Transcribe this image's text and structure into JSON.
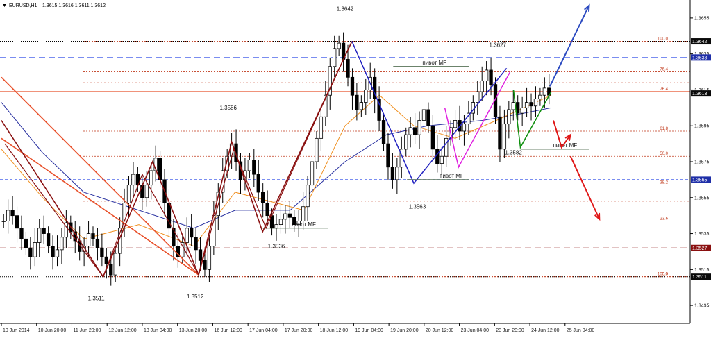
{
  "window": {
    "symbol_title": "EURUSD,H1",
    "ohlc": "1.3615 1.3616 1.3611 1.3612",
    "dropdown_glyph": "▼"
  },
  "colors": {
    "background": "#ffffff",
    "candle": "#000000",
    "fib": "#c0391b",
    "blue_dash": "#2a49e8",
    "price_box": "#0a0a0a",
    "price_box_blue": "#1f2fa8",
    "price_box_red": "#8a1010",
    "price_box_text": "#ffffff",
    "ma_fast": "#f09020",
    "ma_slow": "#2830a0",
    "zigzag_dark": "#8a1010",
    "zigzag_red": "#e8502a",
    "zigzag_blue": "#2020c0",
    "zigzag_magenta": "#e020e0",
    "zigzag_green": "#109010",
    "arrow_blue": "#2a49c0",
    "arrow_red": "#e01818",
    "pivot_line": "#3a5a3a"
  },
  "chart_data": {
    "type": "candlestick",
    "instrument": "EURUSD",
    "timeframe": "H1",
    "ylim": [
      1.3485,
      1.3665
    ],
    "y_ticks": [
      1.3495,
      1.3515,
      1.3535,
      1.3555,
      1.3575,
      1.3595,
      1.3615,
      1.3635,
      1.3655
    ],
    "x_ticks": [
      "10 Jun 2014",
      "10 Jun 20:00",
      "11 Jun 20:00",
      "12 Jun 12:00",
      "13 Jun 04:00",
      "13 Jun 20:00",
      "16 Jun 12:00",
      "17 Jun 04:00",
      "17 Jun 20:00",
      "18 Jun 12:00",
      "19 Jun 04:00",
      "19 Jun 20:00",
      "20 Jun 12:00",
      "23 Jun 04:00",
      "23 Jun 20:00",
      "24 Jun 12:00",
      "25 Jun 04:00"
    ],
    "closes": [
      1.3542,
      1.3548,
      1.3545,
      1.3538,
      1.3532,
      1.3527,
      1.3522,
      1.353,
      1.3538,
      1.3535,
      1.3528,
      1.3522,
      1.3526,
      1.3533,
      1.3541,
      1.3536,
      1.3531,
      1.3525,
      1.3528,
      1.3535,
      1.3532,
      1.3527,
      1.3522,
      1.3518,
      1.3512,
      1.3524,
      1.3538,
      1.3552,
      1.3562,
      1.3568,
      1.3562,
      1.3555,
      1.3562,
      1.357,
      1.3577,
      1.3565,
      1.3552,
      1.3538,
      1.3528,
      1.3522,
      1.353,
      1.3538,
      1.3533,
      1.3526,
      1.352,
      1.3515,
      1.3528,
      1.3545,
      1.3558,
      1.357,
      1.3578,
      1.3585,
      1.3575,
      1.3565,
      1.357,
      1.3576,
      1.3568,
      1.3558,
      1.3552,
      1.3545,
      1.3538,
      1.354,
      1.3543,
      1.3546,
      1.3544,
      1.354,
      1.3542,
      1.355,
      1.3562,
      1.3575,
      1.3588,
      1.36,
      1.3612,
      1.3628,
      1.3638,
      1.3641,
      1.3632,
      1.3622,
      1.3612,
      1.3604,
      1.3608,
      1.3615,
      1.3622,
      1.361,
      1.3598,
      1.3585,
      1.3572,
      1.3565,
      1.3572,
      1.3582,
      1.359,
      1.3594,
      1.359,
      1.3598,
      1.3604,
      1.3595,
      1.3582,
      1.3574,
      1.3578,
      1.3588,
      1.3594,
      1.3598,
      1.3592,
      1.3596,
      1.3602,
      1.3608,
      1.3614,
      1.362,
      1.3626,
      1.3618,
      1.36,
      1.3582,
      1.3596,
      1.3604,
      1.3608,
      1.3602,
      1.3605,
      1.3608,
      1.3606,
      1.361,
      1.3612,
      1.3616,
      1.3612
    ],
    "fib_levels": [
      {
        "label": "100.0",
        "price": 1.3642
      },
      {
        "label": "76.4",
        "price": 1.3625
      },
      {
        "label": "76.4",
        "price": 1.3614
      },
      {
        "label": "61.8",
        "price": 1.3592
      },
      {
        "label": "50.0",
        "price": 1.3578
      },
      {
        "label": "38.2",
        "price": 1.3562
      },
      {
        "label": "23.6",
        "price": 1.3542
      },
      {
        "label": "0.0",
        "price": 1.3511
      },
      {
        "label": "100.0",
        "price": 1.3511
      }
    ],
    "extra_levels": [
      1.3619,
      1.3596,
      1.3553
    ],
    "dashed_lines": [
      {
        "price": 1.3633,
        "style": "long-dash",
        "color": "blue_dash"
      },
      {
        "price": 1.3565,
        "style": "dash",
        "color": "blue_dash"
      },
      {
        "price": 1.3527,
        "style": "long-dash",
        "color": "zigzag_dark"
      },
      {
        "price": 1.3642,
        "style": "dot",
        "color": "candle"
      },
      {
        "price": 1.3511,
        "style": "dot",
        "color": "candle"
      },
      {
        "price": 1.3614,
        "style": "solid",
        "color": "zigzag_red"
      }
    ],
    "price_boxes": [
      {
        "price": 1.3642,
        "text": "1.3642",
        "color": "price_box"
      },
      {
        "price": 1.3633,
        "text": "1.3633",
        "color": "price_box_blue"
      },
      {
        "price": 1.3613,
        "text": "1.3613",
        "color": "price_box"
      },
      {
        "price": 1.3565,
        "text": "1.3565",
        "color": "price_box_blue"
      },
      {
        "price": 1.3527,
        "text": "1.3527",
        "color": "price_box_red"
      },
      {
        "price": 1.3511,
        "text": "1.3511",
        "color": "price_box"
      }
    ],
    "swing_labels": [
      {
        "text": "1.3642",
        "t": 0.5,
        "price": 1.3659
      },
      {
        "text": "1.3627",
        "t": 0.722,
        "price": 1.3639
      },
      {
        "text": "1.3586",
        "t": 0.33,
        "price": 1.3604
      },
      {
        "text": "1.3582",
        "t": 0.745,
        "price": 1.3579
      },
      {
        "text": "1.3563",
        "t": 0.605,
        "price": 1.3549
      },
      {
        "text": "1.3536",
        "t": 0.4,
        "price": 1.3527
      },
      {
        "text": "1.3511",
        "t": 0.138,
        "price": 1.3498
      },
      {
        "text": "1.3512",
        "t": 0.282,
        "price": 1.3499
      }
    ],
    "pivots": [
      {
        "text": "пивот MF",
        "t0": 0.57,
        "t1": 0.68,
        "price": 1.3628,
        "tx": 0.63
      },
      {
        "text": "пивот MF",
        "t0": 0.59,
        "t1": 0.68,
        "price": 1.3565,
        "tx": 0.655
      },
      {
        "text": "пивот MF",
        "t0": 0.38,
        "t1": 0.475,
        "price": 1.3538,
        "tx": 0.44
      },
      {
        "text": "пивот MF",
        "t0": 0.755,
        "t1": 0.855,
        "price": 1.3582,
        "tx": 0.82
      }
    ],
    "zigzag_dark": [
      [
        0.0,
        1.3598
      ],
      [
        0.148,
        1.3511
      ],
      [
        0.22,
        1.3575
      ],
      [
        0.287,
        1.3512
      ],
      [
        0.335,
        1.3586
      ],
      [
        0.38,
        1.3536
      ],
      [
        0.51,
        1.3642
      ]
    ],
    "zigzag_dark_inner": [
      [
        0.005,
        1.3585
      ],
      [
        0.148,
        1.3511
      ],
      [
        0.205,
        1.3568
      ],
      [
        0.287,
        1.3512
      ],
      [
        0.338,
        1.3582
      ],
      [
        0.385,
        1.3538
      ],
      [
        0.505,
        1.3638
      ]
    ],
    "zigzag_red": [
      [
        0.0,
        1.3622
      ],
      [
        0.287,
        1.3512
      ],
      [
        0.0,
        1.3588
      ]
    ],
    "zigzag_blue": [
      [
        0.51,
        1.3642
      ],
      [
        0.6,
        1.3563
      ],
      [
        0.735,
        1.3627
      ]
    ],
    "zigzag_magenta": [
      [
        0.645,
        1.3605
      ],
      [
        0.665,
        1.3572
      ],
      [
        0.74,
        1.3625
      ]
    ],
    "zigzag_green": [
      [
        0.745,
        1.3615
      ],
      [
        0.755,
        1.3583
      ],
      [
        0.8,
        1.3614
      ]
    ],
    "arrow_up": [
      [
        0.798,
        1.3617
      ],
      [
        0.855,
        1.3662
      ]
    ],
    "arrow_down_short": [
      [
        0.803,
        1.3598
      ],
      [
        0.815,
        1.3583
      ],
      [
        0.828,
        1.359
      ]
    ],
    "arrow_down_long": [
      [
        0.828,
        1.3578
      ],
      [
        0.87,
        1.3543
      ]
    ],
    "ma_fast": [
      [
        0.0,
        1.3582
      ],
      [
        0.06,
        1.3555
      ],
      [
        0.12,
        1.3532
      ],
      [
        0.2,
        1.354
      ],
      [
        0.28,
        1.3528
      ],
      [
        0.34,
        1.3558
      ],
      [
        0.4,
        1.3552
      ],
      [
        0.44,
        1.3548
      ],
      [
        0.5,
        1.3595
      ],
      [
        0.55,
        1.3612
      ],
      [
        0.6,
        1.3595
      ],
      [
        0.66,
        1.3588
      ],
      [
        0.72,
        1.3598
      ],
      [
        0.76,
        1.3605
      ],
      [
        0.8,
        1.3612
      ]
    ],
    "ma_slow": [
      [
        0.0,
        1.3608
      ],
      [
        0.06,
        1.358
      ],
      [
        0.12,
        1.3558
      ],
      [
        0.2,
        1.3548
      ],
      [
        0.28,
        1.3538
      ],
      [
        0.34,
        1.3548
      ],
      [
        0.42,
        1.3548
      ],
      [
        0.5,
        1.3575
      ],
      [
        0.56,
        1.359
      ],
      [
        0.62,
        1.3595
      ],
      [
        0.7,
        1.3598
      ],
      [
        0.76,
        1.3602
      ],
      [
        0.8,
        1.3605
      ]
    ]
  }
}
